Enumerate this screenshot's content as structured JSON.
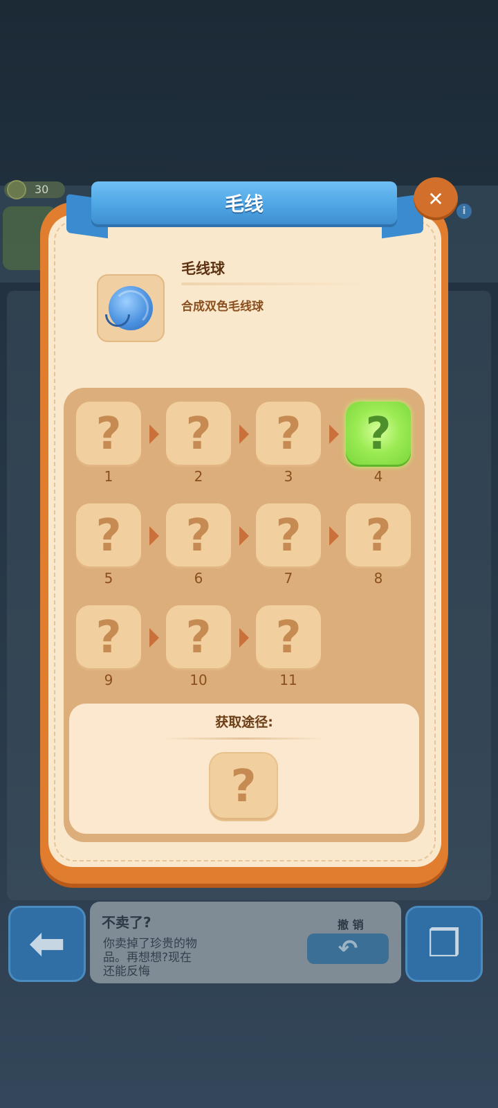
{
  "background": {
    "coin_count": "30",
    "info_icon": "i"
  },
  "popup": {
    "title": "毛线",
    "close_icon": "close-icon",
    "close_glyph": "✕",
    "item": {
      "name": "毛线球",
      "description": "合成双色毛线球",
      "icon": "yarn-ball-icon"
    },
    "chain": {
      "active_level": "4",
      "levels": [
        {
          "label": "1",
          "glyph": "?"
        },
        {
          "label": "2",
          "glyph": "?"
        },
        {
          "label": "3",
          "glyph": "?"
        },
        {
          "label": "4",
          "glyph": "?"
        },
        {
          "label": "5",
          "glyph": "?"
        },
        {
          "label": "6",
          "glyph": "?"
        },
        {
          "label": "7",
          "glyph": "?"
        },
        {
          "label": "8",
          "glyph": "?"
        },
        {
          "label": "9",
          "glyph": "?"
        },
        {
          "label": "10",
          "glyph": "?"
        },
        {
          "label": "11",
          "glyph": "?"
        }
      ]
    },
    "source": {
      "title": "获取途径:",
      "glyph": "?"
    }
  },
  "bottom_bar": {
    "back_glyph": "⬅",
    "info_title": "不卖了?",
    "info_lines": [
      "你卖掉了珍贵的物",
      "品。再想想?现在",
      "还能反悔"
    ],
    "undo_label": "撤 销",
    "undo_glyph": "↶",
    "box_glyph": "❒"
  },
  "colors": {
    "popup_border": "#e07d2f",
    "popup_fill": "#fae8cc",
    "ribbon": "#4ea6e4",
    "active_tile": "#9ceb55"
  }
}
